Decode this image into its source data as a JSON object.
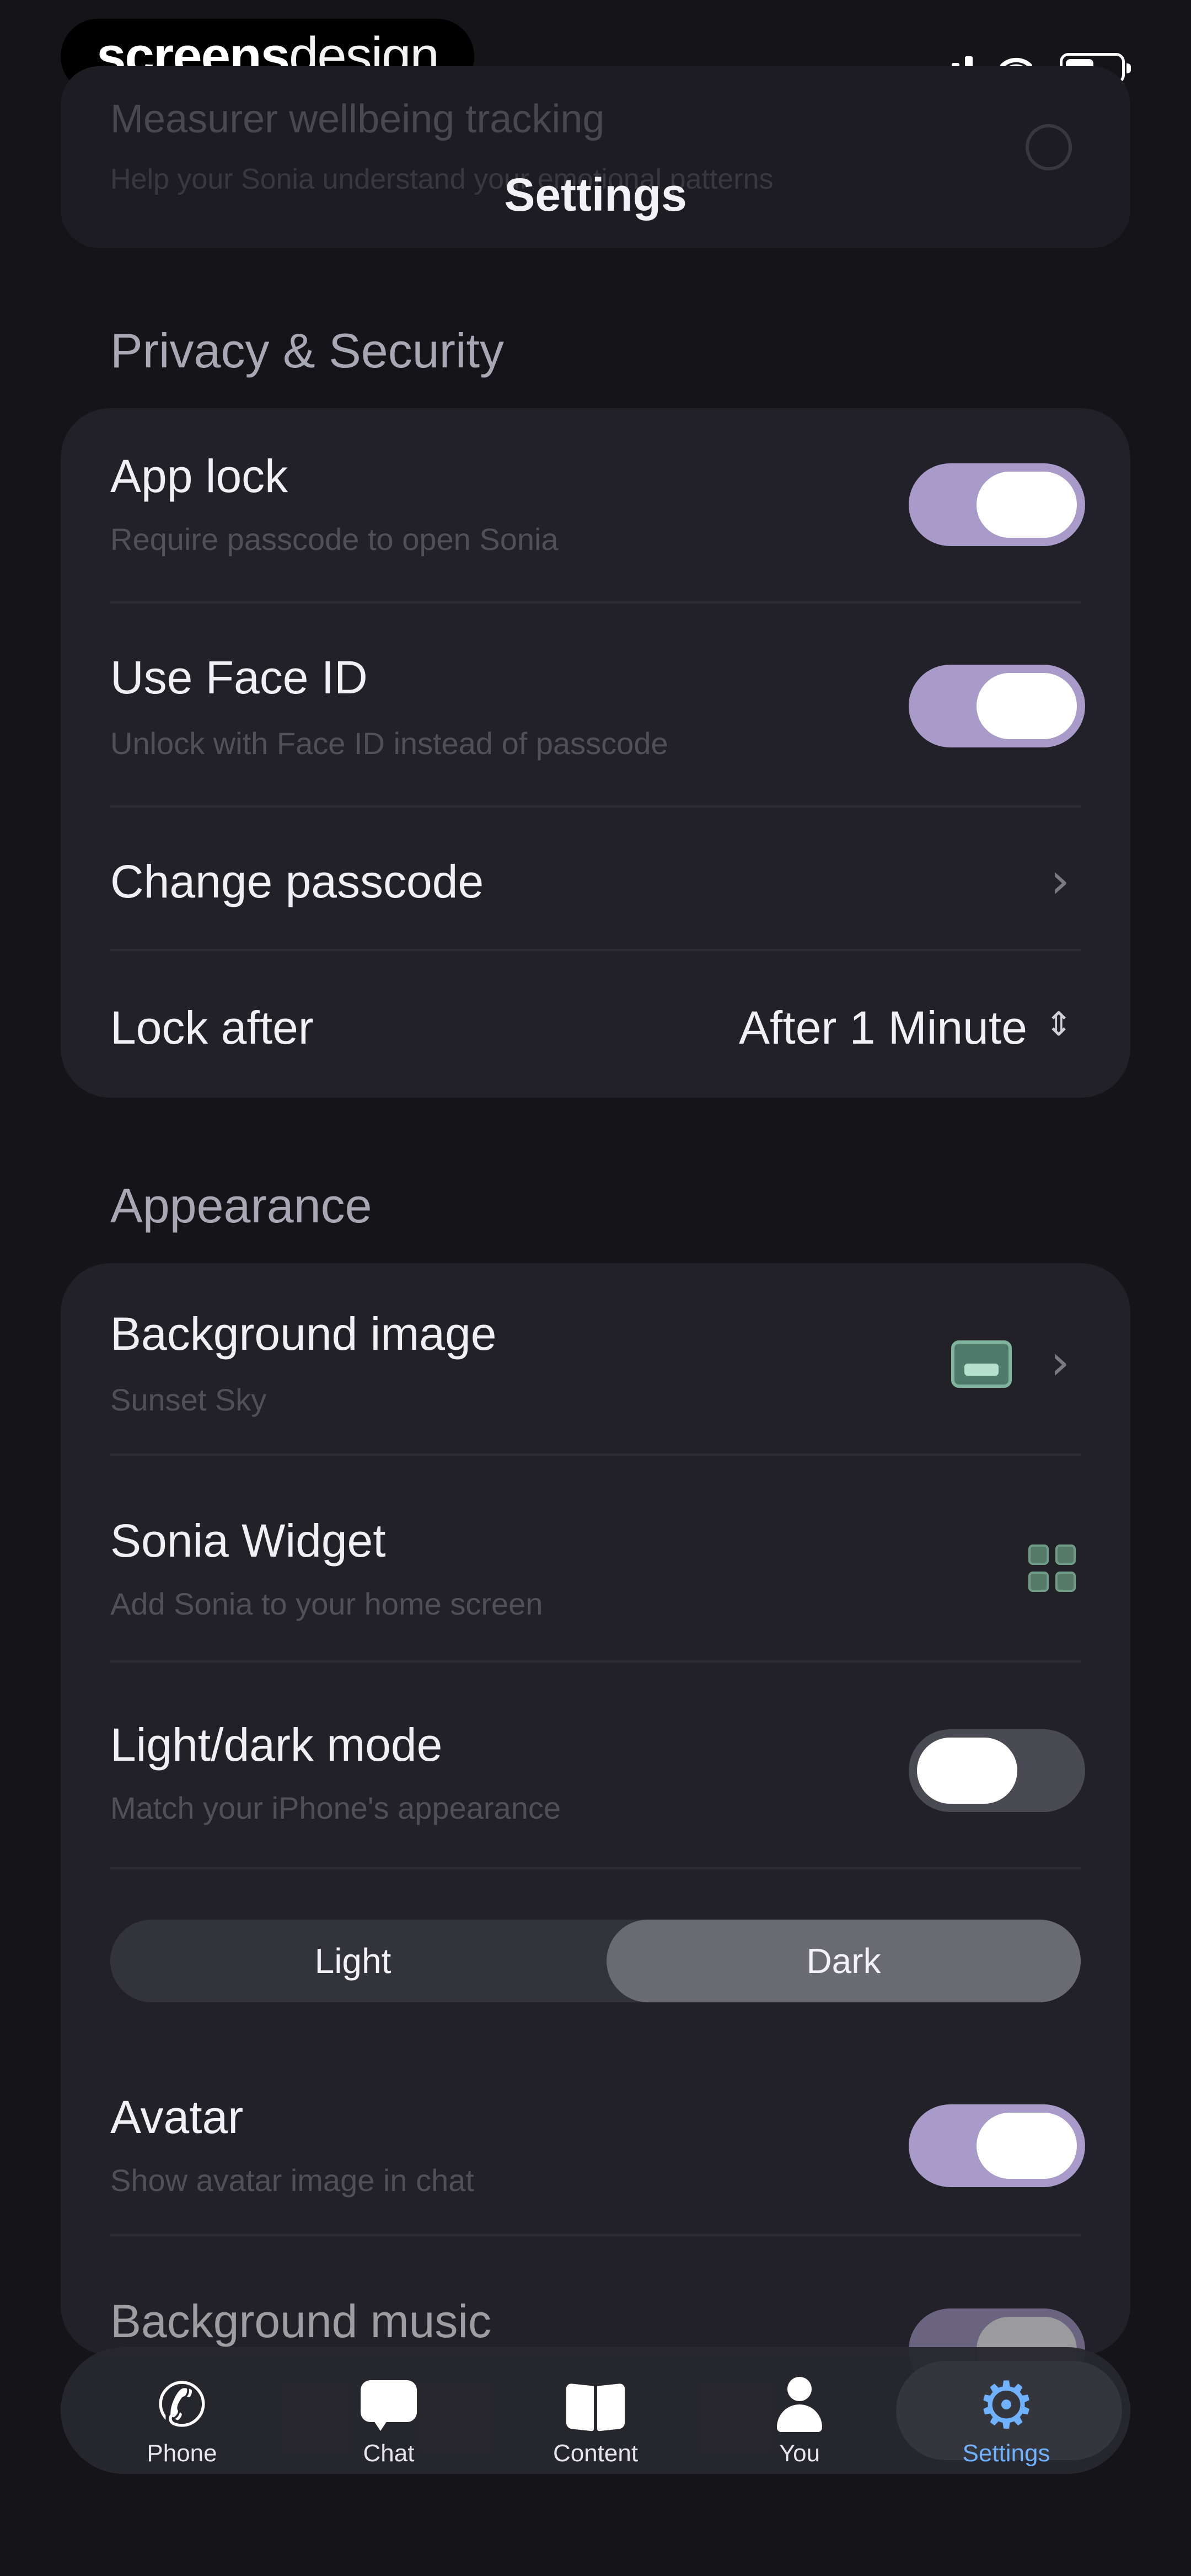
{
  "brand": {
    "bold": "screens",
    "light": "design"
  },
  "header": {
    "title": "Settings",
    "obscured_row_title": "Measurer wellbeing tracking",
    "obscured_row_subtitle": "Help your Sonia understand your emotional patterns"
  },
  "privacy": {
    "section_label": "Privacy & Security",
    "app_lock": {
      "label": "App lock",
      "sublabel": "Require passcode to open Sonia",
      "enabled": true
    },
    "face_id": {
      "label": "Use Face ID",
      "sublabel": "Unlock with Face ID instead of passcode",
      "enabled": true
    },
    "change_passcode": {
      "label": "Change passcode"
    },
    "lock_after": {
      "label": "Lock after",
      "value": "After 1 Minute"
    }
  },
  "appearance": {
    "section_label": "Appearance",
    "background_image": {
      "label": "Background image",
      "sublabel": "Sunset Sky"
    },
    "widget": {
      "label": "Sonia Widget",
      "sublabel": "Add Sonia to your home screen"
    },
    "light_dark": {
      "label": "Light/dark mode",
      "sublabel": "Match your iPhone's appearance",
      "enabled": false
    },
    "mode_segment": {
      "options": [
        "Light",
        "Dark"
      ],
      "selected": "Dark"
    },
    "avatar": {
      "label": "Avatar",
      "sublabel": "Show avatar image in chat",
      "enabled": true
    },
    "background_music": {
      "label": "Background music",
      "enabled": true
    }
  },
  "tabs": [
    {
      "label": "Phone",
      "icon": "phone-icon",
      "active": false
    },
    {
      "label": "Chat",
      "icon": "chat-icon",
      "active": false
    },
    {
      "label": "Content",
      "icon": "book-icon",
      "active": false
    },
    {
      "label": "You",
      "icon": "person-icon",
      "active": false
    },
    {
      "label": "Settings",
      "icon": "gear-icon",
      "active": true
    }
  ],
  "colors": {
    "background": "#141419",
    "card": "#212127",
    "toggle_on": "#a99bc9",
    "accent_blue": "#6fb2ff"
  }
}
